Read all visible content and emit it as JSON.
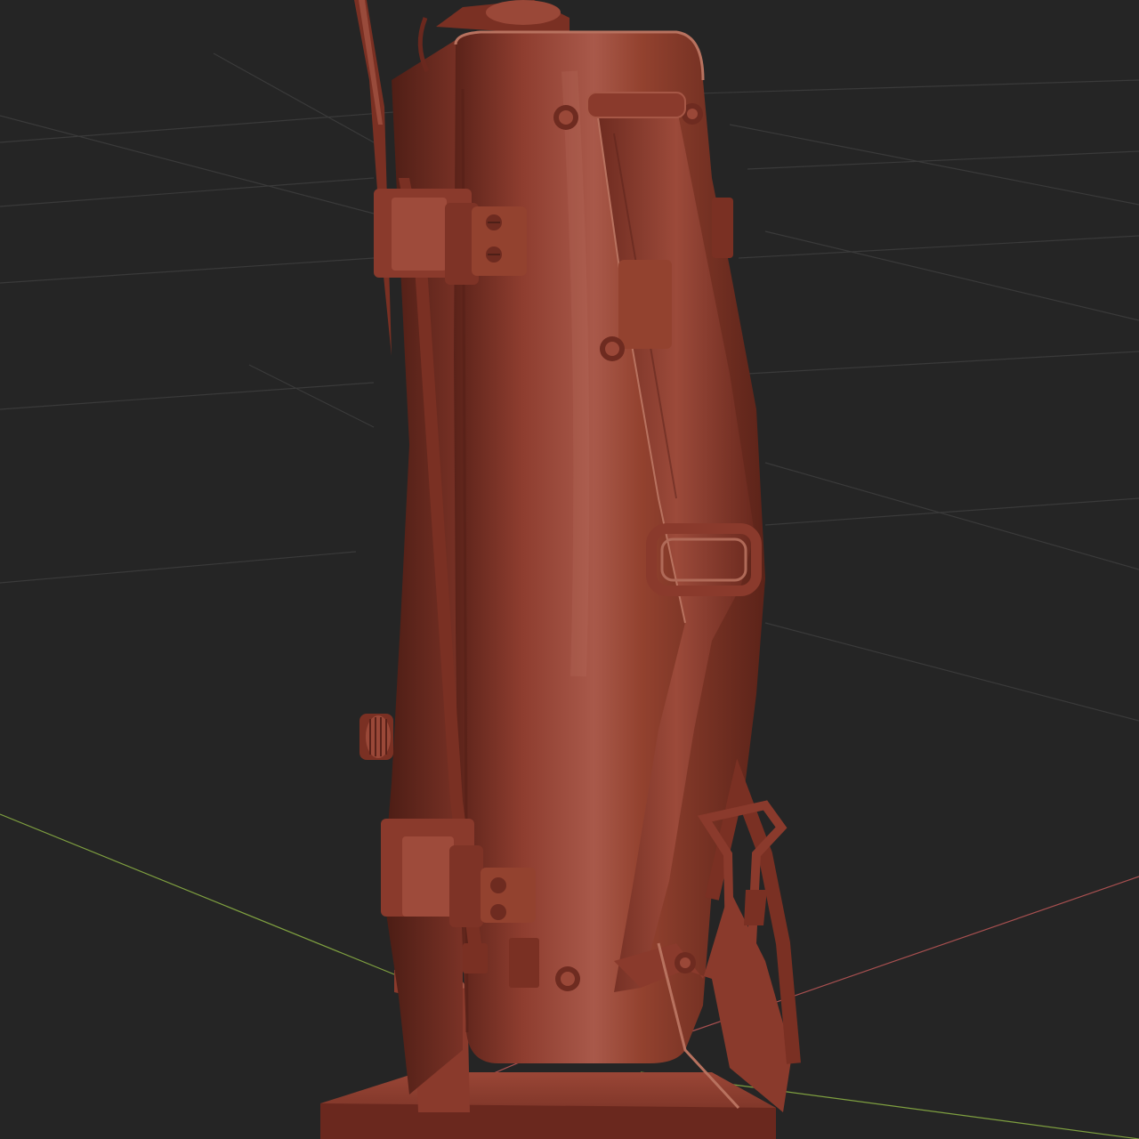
{
  "viewport": {
    "background": "#252525",
    "grid_color": "#3a3a3a",
    "x_axis_color": "#a85050",
    "y_axis_color": "#7fa040"
  },
  "model": {
    "material_color": "#8a3a2c",
    "highlight_color": "#b06a58",
    "shadow_color": "#4e1f17"
  }
}
